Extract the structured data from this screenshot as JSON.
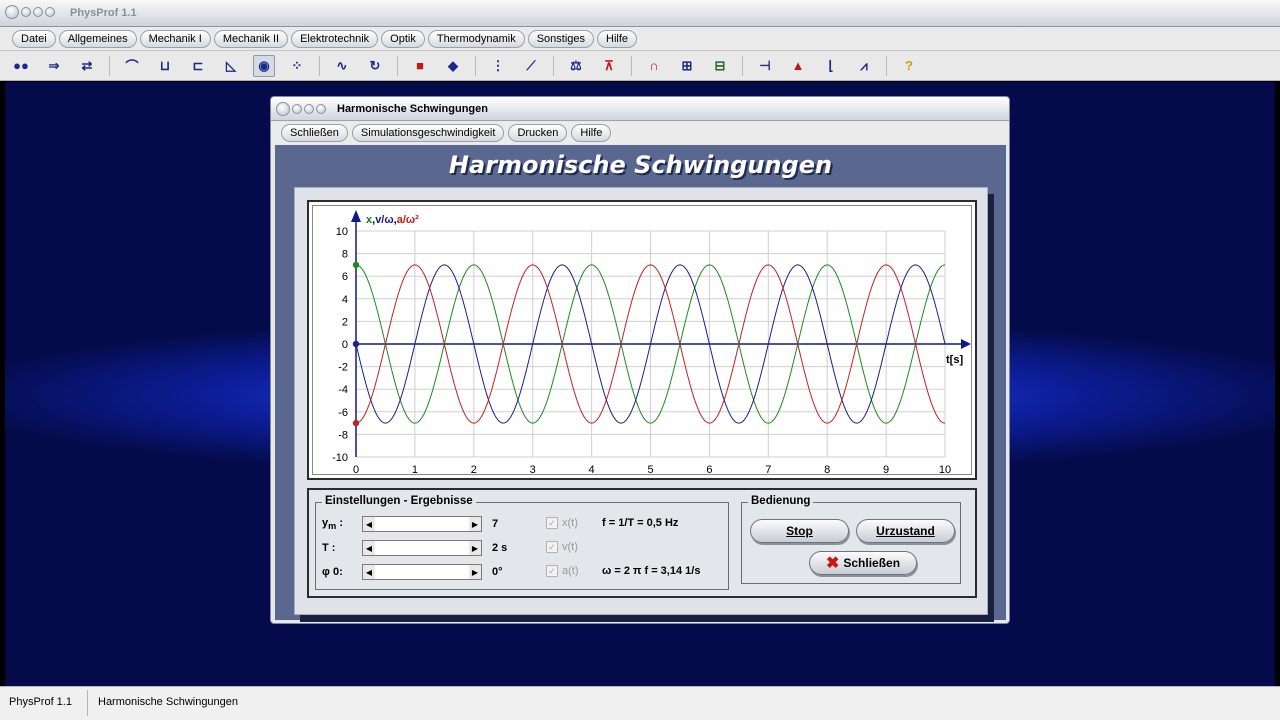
{
  "app": {
    "title": "PhysProf 1.1"
  },
  "menubar": [
    {
      "label": "Datei"
    },
    {
      "label": "Allgemeines"
    },
    {
      "label": "Mechanik I"
    },
    {
      "label": "Mechanik II"
    },
    {
      "label": "Elektrotechnik"
    },
    {
      "label": "Optik"
    },
    {
      "label": "Thermodynamik"
    },
    {
      "label": "Sonstiges"
    },
    {
      "label": "Hilfe"
    }
  ],
  "toolbar": {
    "icons": [
      "balls-icon",
      "forward-icon",
      "swap-icon",
      "hill-icon",
      "measure-icon",
      "slide-icon",
      "incline-icon",
      "eye-icon",
      "dots-icon",
      "wave-icon",
      "rotate-icon",
      "mass-icon",
      "block-icon",
      "spring-icon",
      "graph-icon",
      "scale-icon",
      "resistor-icon",
      "magnet-icon",
      "circuit-icon",
      "component-icon",
      "lever-icon",
      "prism-icon",
      "decay-icon",
      "distribution-icon",
      "help-icon"
    ]
  },
  "window": {
    "title": "Harmonische Schwingungen",
    "menu": [
      {
        "label": "Schließen"
      },
      {
        "label": "Simulationsgeschwindigkeit"
      },
      {
        "label": "Drucken"
      },
      {
        "label": "Hilfe"
      }
    ],
    "heading": "Harmonische Schwingungen"
  },
  "settings": {
    "legend": "Einstellungen - Ergebnisse",
    "ym_label": "y",
    "ym_sub": "m",
    "ym_value": "7",
    "t_label": "T :",
    "t_value": "2 s",
    "phi_label": "φ",
    "phi_sub": "0",
    "phi_value": "0°",
    "check_x": "x(t)",
    "check_v": "v(t)",
    "check_a": "a(t)",
    "formula_f": "f = 1/T  =  0,5 Hz",
    "formula_w": "ω  = 2 π f  =   3,14 1/s"
  },
  "bedienung": {
    "legend": "Bedienung",
    "stop": "Stop",
    "reset": "Urzustand",
    "close": "Schließen"
  },
  "status": {
    "app": "PhysProf 1.1",
    "module": "Harmonische Schwingungen"
  },
  "chart_data": {
    "type": "line",
    "ylabel_parts": [
      {
        "text": "x",
        "color": "#1a7a1a"
      },
      {
        "text": ",",
        "color": "#000000"
      },
      {
        "text": "v/ω",
        "color": "#101a8a"
      },
      {
        "text": ",",
        "color": "#000000"
      },
      {
        "text": "a/ω²",
        "color": "#c41818"
      }
    ],
    "xlabel": "t[s]",
    "xlim": [
      0,
      10
    ],
    "ylim": [
      -10,
      10
    ],
    "xticks": [
      0,
      1,
      2,
      3,
      4,
      5,
      6,
      7,
      8,
      9,
      10
    ],
    "yticks": [
      10,
      8,
      6,
      4,
      2,
      0,
      -2,
      -4,
      -6,
      -8,
      -10
    ],
    "grid": true,
    "amplitude": 7,
    "period": 2,
    "series": [
      {
        "color": "#1d8a1d",
        "x": [
          0,
          0.5,
          1,
          1.5,
          2,
          2.5,
          3,
          3.5,
          4,
          4.5,
          5,
          5.5,
          6,
          6.5,
          7,
          7.5,
          8,
          8.5,
          9,
          9.5,
          10
        ],
        "y": [
          7,
          0,
          -7,
          0,
          7,
          0,
          -7,
          0,
          7,
          0,
          -7,
          0,
          7,
          0,
          -7,
          0,
          7,
          0,
          -7,
          0,
          7
        ]
      },
      {
        "color": "#1b1f8f",
        "x": [
          0,
          0.5,
          1,
          1.5,
          2,
          2.5,
          3,
          3.5,
          4,
          4.5,
          5,
          5.5,
          6,
          6.5,
          7,
          7.5,
          8,
          8.5,
          9,
          9.5,
          10
        ],
        "y": [
          0,
          -7,
          0,
          7,
          0,
          -7,
          0,
          7,
          0,
          -7,
          0,
          7,
          0,
          -7,
          0,
          7,
          0,
          -7,
          0,
          7,
          0
        ]
      },
      {
        "color": "#c12222",
        "x": [
          0,
          0.5,
          1,
          1.5,
          2,
          2.5,
          3,
          3.5,
          4,
          4.5,
          5,
          5.5,
          6,
          6.5,
          7,
          7.5,
          8,
          8.5,
          9,
          9.5,
          10
        ],
        "y": [
          -7,
          0,
          7,
          0,
          -7,
          0,
          7,
          0,
          -7,
          0,
          7,
          0,
          -7,
          0,
          7,
          0,
          -7,
          0,
          7,
          0,
          -7
        ]
      }
    ]
  }
}
